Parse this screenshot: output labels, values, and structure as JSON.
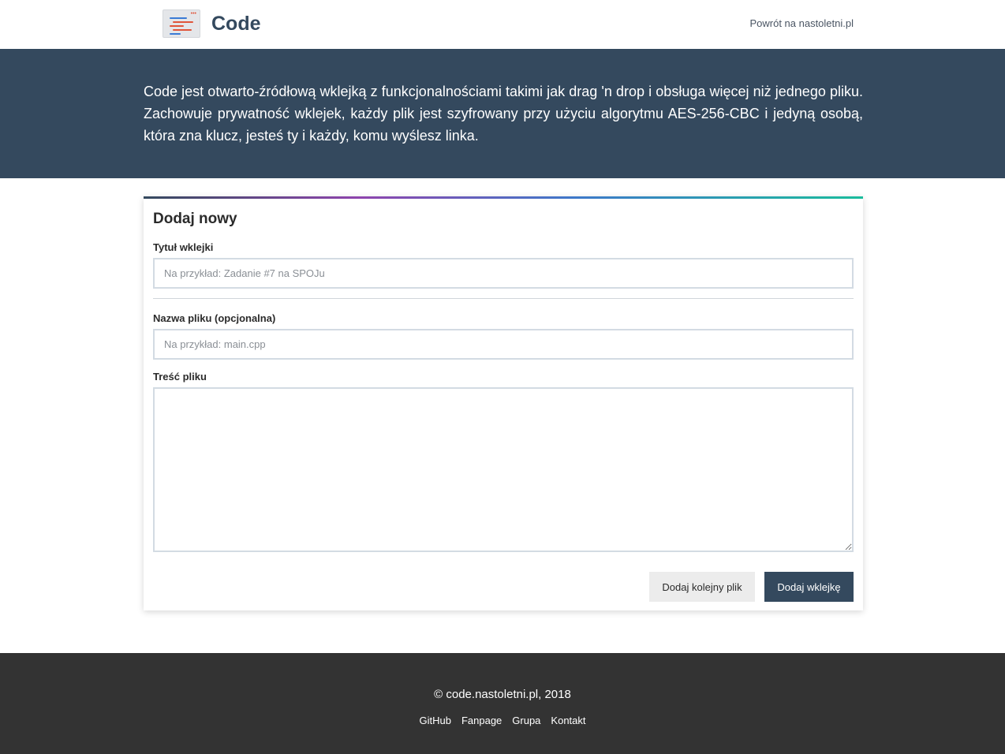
{
  "header": {
    "brand_name": "Code",
    "back_link": "Powrót na nastoletni.pl"
  },
  "hero": {
    "description": "Code jest otwarto-źródłową wklejką z funkcjonalnościami takimi jak drag 'n drop i obsługa więcej niż jednego pliku. Zachowuje prywatność wklejek, każdy plik jest szyfrowany przy użyciu algorytmu AES-256-CBC i jedyną osobą, która zna klucz, jesteś ty i każdy, komu wyślesz linka."
  },
  "form": {
    "title": "Dodaj nowy",
    "paste_title": {
      "label": "Tytuł wklejki",
      "placeholder": "Na przykład: Zadanie #7 na SPOJu",
      "value": ""
    },
    "file_name": {
      "label": "Nazwa pliku (opcjonalna)",
      "placeholder": "Na przykład: main.cpp",
      "value": ""
    },
    "file_content": {
      "label": "Treść pliku",
      "value": ""
    },
    "add_file_button": "Dodaj kolejny plik",
    "submit_button": "Dodaj wklejkę"
  },
  "footer": {
    "copyright": "© code.nastoletni.pl, 2018",
    "links": [
      "GitHub",
      "Fanpage",
      "Grupa",
      "Kontakt"
    ]
  },
  "colors": {
    "primary": "#34495e",
    "footer_bg": "#333333",
    "secondary_button_bg": "#ececec"
  }
}
